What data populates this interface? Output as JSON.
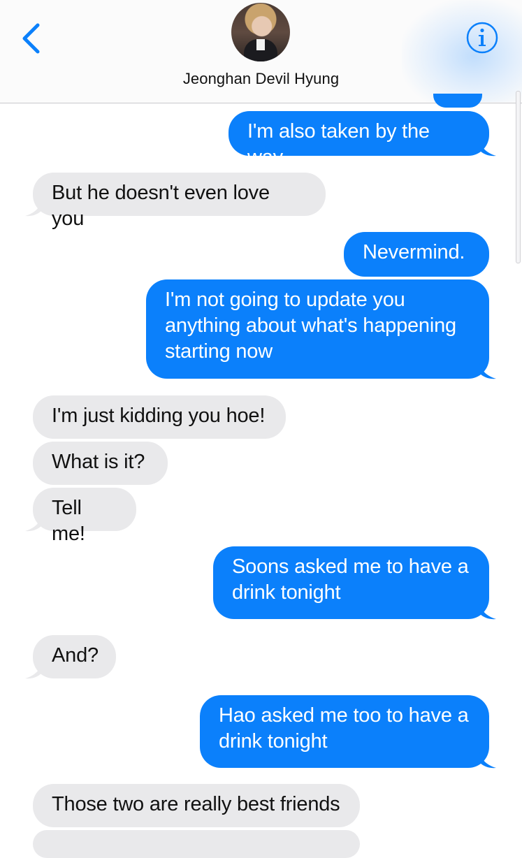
{
  "header": {
    "contact_name": "Jeonghan Devil Hyung",
    "back_icon": "chevron-left-icon",
    "info_icon": "info-icon",
    "accent_color": "#0b80fb"
  },
  "messages": [
    {
      "direction": "sent",
      "text": "I'm also taken by the way"
    },
    {
      "direction": "received",
      "text": "But he doesn't even love you"
    },
    {
      "direction": "sent",
      "text": "Nevermind."
    },
    {
      "direction": "sent",
      "text": "I'm not going to update you anything about what's happening starting now"
    },
    {
      "direction": "received",
      "text": "I'm just kidding you hoe!"
    },
    {
      "direction": "received",
      "text": "What is it?"
    },
    {
      "direction": "received",
      "text": "Tell me!"
    },
    {
      "direction": "sent",
      "text": "Soons asked me to have a drink tonight"
    },
    {
      "direction": "received",
      "text": "And?"
    },
    {
      "direction": "sent",
      "text": "Hao asked me too to have a drink tonight"
    },
    {
      "direction": "received",
      "text": "Those two are really best friends"
    }
  ]
}
